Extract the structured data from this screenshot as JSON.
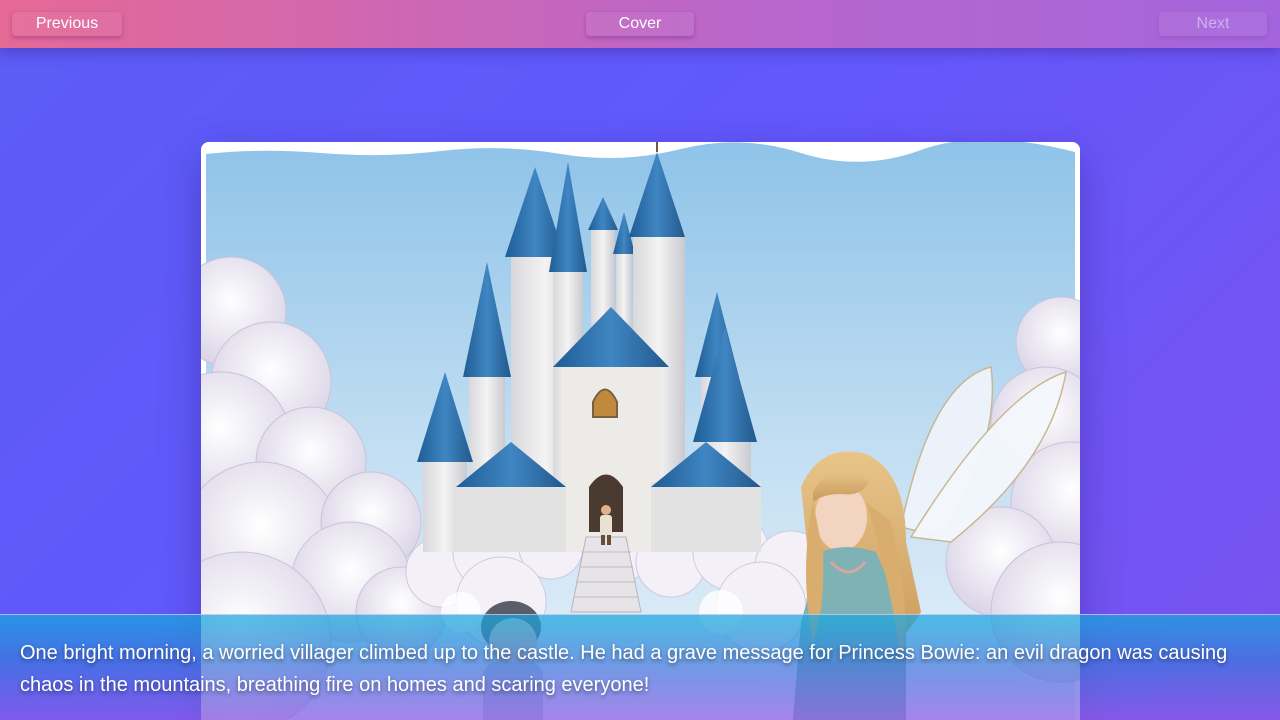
{
  "nav": {
    "previous_label": "Previous",
    "cover_label": "Cover",
    "next_label": "Next",
    "next_enabled": false
  },
  "page": {
    "text": "One bright morning, a worried villager climbed up to the castle. He had a grave message for Princess Bowie: an evil dragon was causing chaos in the mountains, breathing fire on homes and scaring everyone!"
  },
  "colors": {
    "background": "#5b5cf6",
    "topbar_start": "#e56995",
    "topbar_end": "#a465dc",
    "castle_roof": "#2f6fa8"
  },
  "illustration": {
    "subject": "watercolor castle on clouds with villager and fairy"
  }
}
